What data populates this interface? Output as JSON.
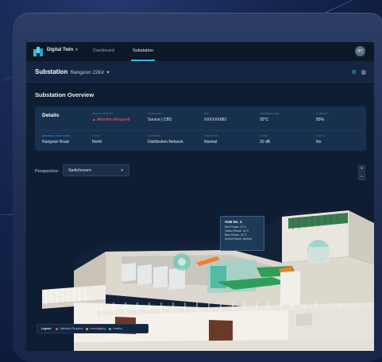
{
  "topbar": {
    "brand": "Digital Twin",
    "nav": [
      {
        "label": "Dashboard",
        "active": false
      },
      {
        "label": "Substation",
        "active": true
      }
    ],
    "avatar_initials": "RT"
  },
  "header": {
    "title": "Substation",
    "subtitle": "Rangoon 22kV"
  },
  "overview_title": "Substation Overview",
  "details": {
    "label": "Details",
    "row1": [
      {
        "label": "HEALTH STATUS",
        "value": "Attention Required",
        "status": "alert"
      },
      {
        "label": "CATEGORY",
        "value": "Source | CBD"
      },
      {
        "label": "NMI",
        "value": "XXXXXX881"
      },
      {
        "label": "TEMPERATURE",
        "value": "35°C"
      },
      {
        "label": "HUMIDITY",
        "value": "85%"
      }
    ],
    "row2": [
      {
        "label": "ADDRESS (Map view)",
        "value": "Rangoon Road"
      },
      {
        "label": "ZONE",
        "value": "North"
      },
      {
        "label": "NETWORK",
        "value": "Distribution Network"
      },
      {
        "label": "VIBRATION",
        "value": "Normal"
      },
      {
        "label": "NOISE",
        "value": "20 dB"
      },
      {
        "label": "FLOOD",
        "value": "No"
      }
    ]
  },
  "perspective": {
    "label": "Perspective:",
    "selected": "Switchroom"
  },
  "zoom": {
    "in": "+",
    "out": "−"
  },
  "tooltip": {
    "title": "SVB No. 3",
    "lines": [
      "Red Phase: 41°C",
      "Yellow Phase: 41°C",
      "Blue Phase: 41°C",
      "Smoke Alarm: Normal"
    ]
  },
  "legend": {
    "title": "Legend",
    "items": [
      {
        "label": "Attention Required",
        "color": "#ff4d5e"
      },
      {
        "label": "Investigating",
        "color": "#f5a623"
      },
      {
        "label": "Healthy",
        "color": "#35d6c8"
      }
    ]
  },
  "colors": {
    "accent": "#3bb4ff",
    "alert": "#ff5a6e",
    "healthy": "#35d6c8",
    "highlight": "#f07d2a"
  }
}
